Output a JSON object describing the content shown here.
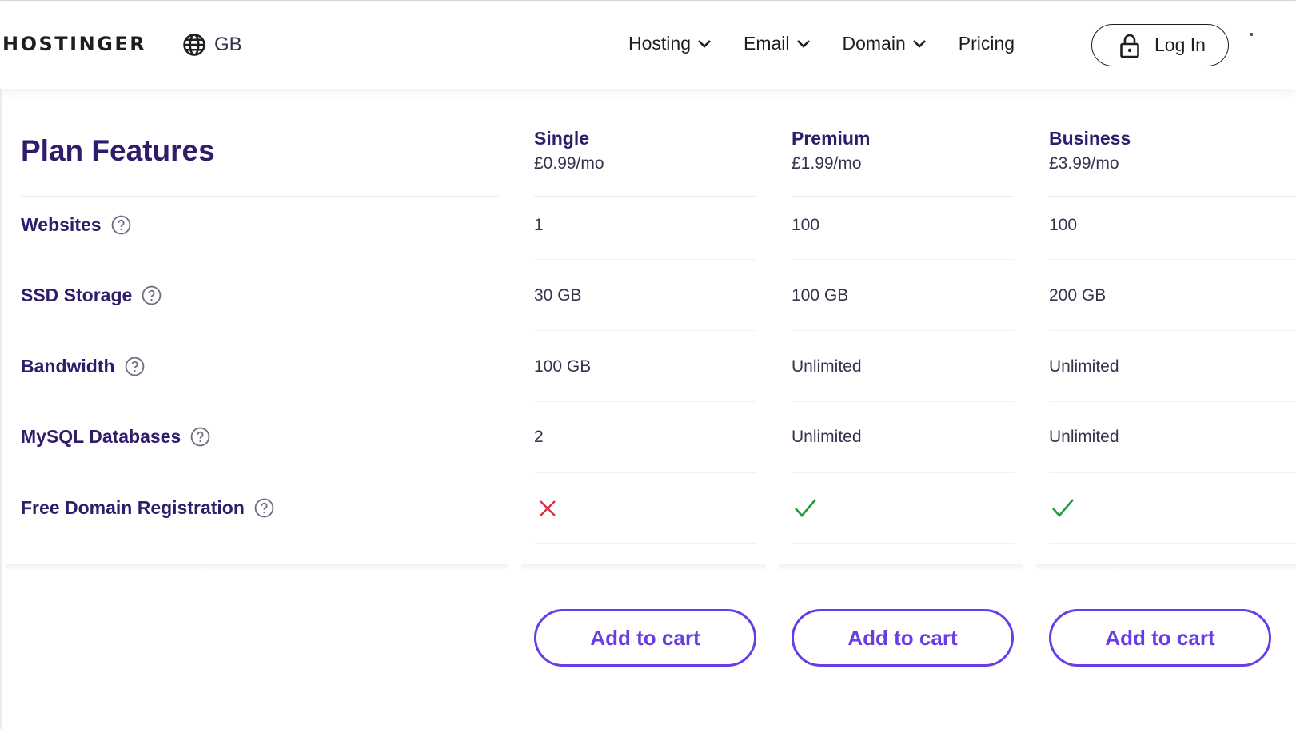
{
  "header": {
    "logo": "HOSTINGER",
    "locale": {
      "icon": "globe-icon",
      "label": "GB"
    },
    "nav": [
      {
        "label": "Hosting",
        "has_dropdown": true
      },
      {
        "label": "Email",
        "has_dropdown": true
      },
      {
        "label": "Domain",
        "has_dropdown": true
      },
      {
        "label": "Pricing",
        "has_dropdown": false
      }
    ],
    "login": {
      "icon": "lock-icon",
      "label": "Log In"
    }
  },
  "comparison": {
    "title": "Plan Features",
    "plans": [
      {
        "name": "Single",
        "price": "£0.99/mo",
        "cta": "Add to cart"
      },
      {
        "name": "Premium",
        "price": "£1.99/mo",
        "cta": "Add to cart"
      },
      {
        "name": "Business",
        "price": "£3.99/mo",
        "cta": "Add to cart"
      }
    ],
    "features": [
      {
        "label": "Websites",
        "values": [
          "1",
          "100",
          "100"
        ]
      },
      {
        "label": "SSD Storage",
        "values": [
          "30 GB",
          "100 GB",
          "200 GB"
        ]
      },
      {
        "label": "Bandwidth",
        "values": [
          "100 GB",
          "Unlimited",
          "Unlimited"
        ]
      },
      {
        "label": "MySQL Databases",
        "values": [
          "2",
          "Unlimited",
          "Unlimited"
        ]
      },
      {
        "label": "Free Domain Registration",
        "values": [
          false,
          true,
          true
        ]
      }
    ]
  },
  "colors": {
    "brand_purple": "#673de6",
    "heading": "#2f1c6a",
    "check_green": "#00b090",
    "cross_red": "#d63163"
  }
}
